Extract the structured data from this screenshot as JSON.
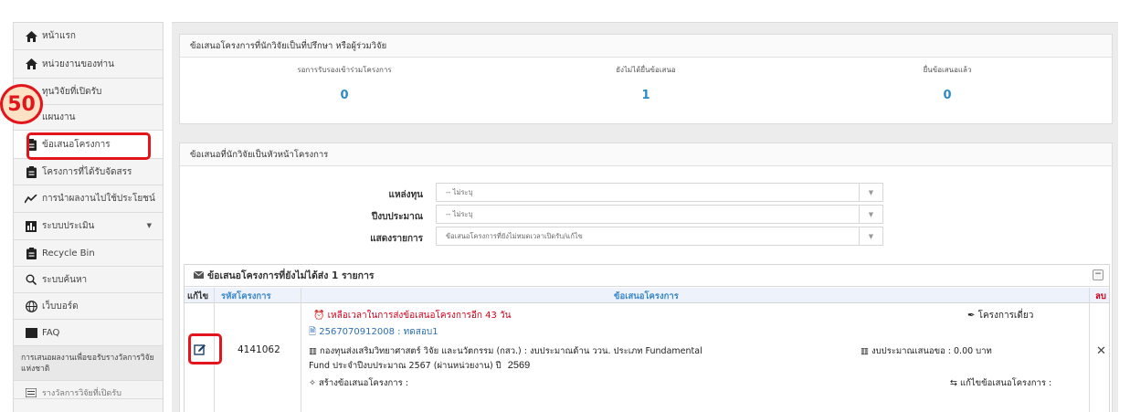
{
  "sidebar": {
    "items": [
      {
        "label": "หน้าแรก",
        "icon": "home-icon"
      },
      {
        "label": "หน่วยงานของท่าน",
        "icon": "home-icon"
      },
      {
        "label": "ทุนวิจัยที่เปิดรับ",
        "icon": "none"
      },
      {
        "label": "แผนงาน",
        "icon": "none"
      },
      {
        "label": "ข้อเสนอโครงการ",
        "icon": "clipboard-icon"
      },
      {
        "label": "โครงการที่ได้รับจัดสรร",
        "icon": "clipboard-icon"
      },
      {
        "label": "การนำผลงานไปใช้ประโยชน์",
        "icon": "trend-icon"
      },
      {
        "label": "ระบบประเมิน",
        "icon": "bar-chart-icon"
      },
      {
        "label": "Recycle Bin",
        "icon": "clipboard-icon"
      },
      {
        "label": "ระบบค้นหา",
        "icon": "search-icon"
      },
      {
        "label": "เว็บบอร์ด",
        "icon": "globe-icon"
      },
      {
        "label": "FAQ",
        "icon": "square-icon"
      },
      {
        "label": "การเสนอผลงานเพื่อขอรับรางวัลการวิจัยแห่งชาติ",
        "icon": "none"
      },
      {
        "label": "รางวัลการวิจัยที่เปิดรับ",
        "icon": "list-icon"
      }
    ],
    "step_badge": "50"
  },
  "advisor_panel": {
    "title": "ข้อเสนอโครงการที่นักวิจัยเป็นที่ปรึกษา หรือผู้ร่วมวิจัย",
    "stats": [
      {
        "label": "รอการรับรองเข้าร่วมโครงการ",
        "value": "0"
      },
      {
        "label": "ยังไม่ได้ยื่นข้อเสนอ",
        "value": "1"
      },
      {
        "label": "ยื่นข้อเสนอแล้ว",
        "value": "0"
      }
    ]
  },
  "leader_panel": {
    "title": "ข้อเสนอที่นักวิจัยเป็นหัวหน้าโครงการ",
    "filters": [
      {
        "label": "แหล่งทุน",
        "value": "-- ไม่ระบุ"
      },
      {
        "label": "ปีงบประมาณ",
        "value": "-- ไม่ระบุ"
      },
      {
        "label": "แสดงรายการ",
        "value": "ข้อเสนอโครงการที่ยังไม่หมดเวลาเปิดรับ/แก้ไข"
      }
    ],
    "list": {
      "title": "ข้อเสนอโครงการที่ยังไม่ได้ส่ง 1 รายการ",
      "collapse": "−",
      "columns": {
        "edit": "แก้ไข",
        "code": "รหัสโครงการ",
        "proposal": "ข้อเสนอโครงการ",
        "delete": "ลบ"
      },
      "rows": [
        {
          "code": "4141062",
          "deadline": "เหลือเวลาในการส่งข้อเสนอโครงการอีก 43 วัน",
          "project_type": "โครงการเดี่ยว",
          "proposal_id": "2567070912008 : ทดสอบ1",
          "fund_line1": "กองทุนส่งเสริมวิทยาศาสตร์ วิจัย และนวัตกรรม (กสว.) : งบประมาณด้าน ววน. ประเภท Fundamental",
          "fund_line2": "Fund ประจำปีงบประมาณ 2567 (ผ่านหน่วยงาน) ปี",
          "year": "2569",
          "budget": "งบประมาณเสนอขอ : 0.00 บาท",
          "create": "สร้างข้อเสนอโครงการ :",
          "edit_label": "แก้ไขข้อเสนอโครงการ :",
          "delete": "✕"
        }
      ]
    }
  },
  "colors": {
    "accent": "#2c8bc6",
    "highlight": "#e3141b",
    "deadline": "#d0021b",
    "delete": "#d0021b"
  }
}
